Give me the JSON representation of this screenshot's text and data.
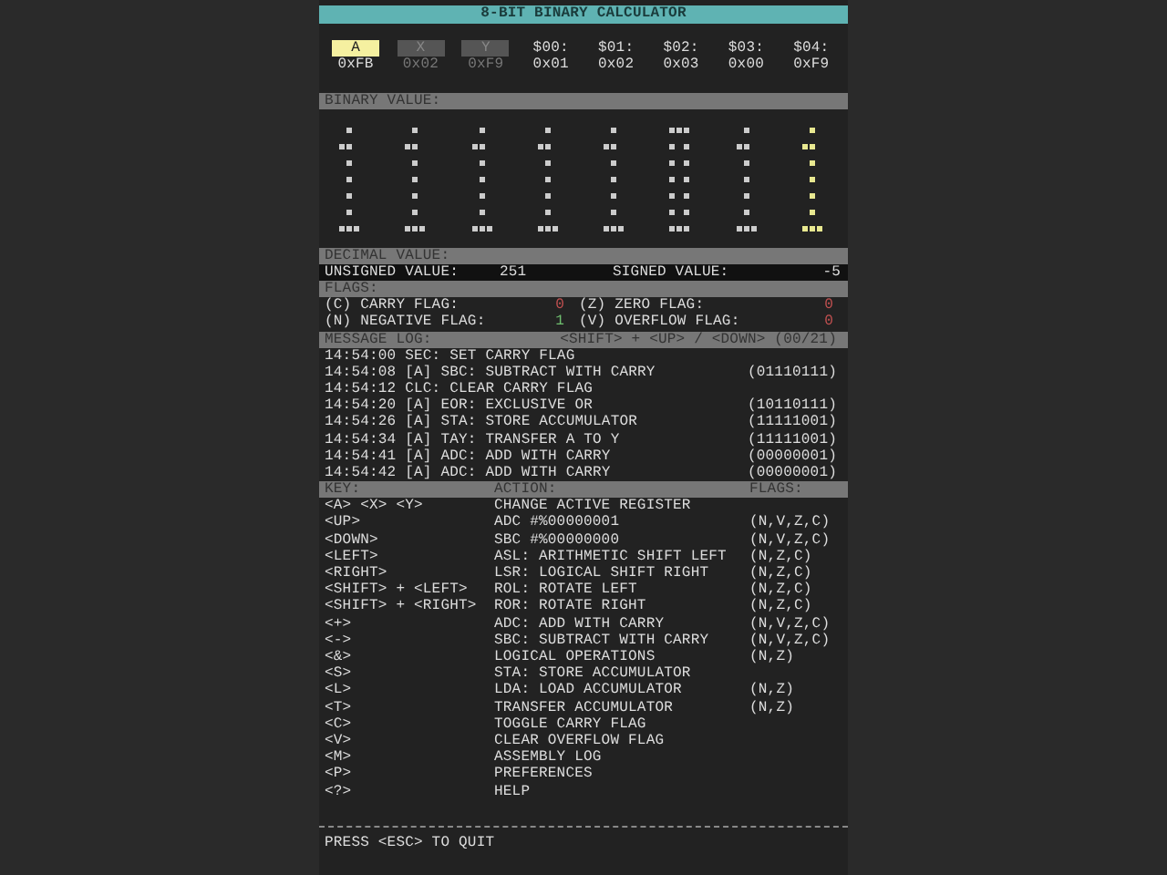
{
  "title": "8-BIT BINARY CALCULATOR",
  "registers": [
    {
      "label": "A",
      "value": "0xFB",
      "kind": "register",
      "selected": true
    },
    {
      "label": "X",
      "value": "0x02",
      "kind": "register",
      "selected": false
    },
    {
      "label": "Y",
      "value": "0xF9",
      "kind": "register",
      "selected": false
    },
    {
      "label": "$00:",
      "value": "0x01",
      "kind": "memory"
    },
    {
      "label": "$01:",
      "value": "0x02",
      "kind": "memory"
    },
    {
      "label": "$02:",
      "value": "0x03",
      "kind": "memory"
    },
    {
      "label": "$03:",
      "value": "0x00",
      "kind": "memory"
    },
    {
      "label": "$04:",
      "value": "0xF9",
      "kind": "memory"
    }
  ],
  "binary_header": "BINARY VALUE:",
  "bits": [
    {
      "on": true,
      "selected": false
    },
    {
      "on": true,
      "selected": false
    },
    {
      "on": true,
      "selected": false
    },
    {
      "on": true,
      "selected": false
    },
    {
      "on": true,
      "selected": false
    },
    {
      "on": false,
      "selected": false
    },
    {
      "on": true,
      "selected": false
    },
    {
      "on": true,
      "selected": true
    }
  ],
  "decimal": {
    "header": "DECIMAL VALUE:",
    "unsigned_label": "UNSIGNED VALUE:",
    "unsigned_value": "251",
    "signed_label": "SIGNED VALUE:",
    "signed_value": "-5"
  },
  "flags": {
    "header": "FLAGS:",
    "items": [
      {
        "label": "(C) CARRY FLAG:",
        "value": "0",
        "set": false
      },
      {
        "label": "(Z) ZERO FLAG:",
        "value": "0",
        "set": false
      },
      {
        "label": "(N) NEGATIVE FLAG:",
        "value": "1",
        "set": true
      },
      {
        "label": "(V) OVERFLOW FLAG:",
        "value": "0",
        "set": false
      }
    ]
  },
  "log": {
    "header": "MESSAGE LOG:",
    "hint": "<SHIFT> + <UP> / <DOWN> (00/21)",
    "entries": [
      {
        "text": "14:54:00 SEC: SET CARRY FLAG"
      },
      {
        "text": "14:54:08 [A] SBC: SUBTRACT WITH CARRY",
        "result": "(01110111)"
      },
      {
        "text": "14:54:12 CLC: CLEAR CARRY FLAG"
      },
      {
        "text": "14:54:20 [A] EOR: EXCLUSIVE OR",
        "result": "(10110111)"
      },
      {
        "text": "14:54:26 [A] STA: STORE ACCUMULATOR",
        "result": "(11111001)"
      },
      {
        "text": "14:54:34 [A] TAY: TRANSFER A TO Y",
        "result": "(11111001)"
      },
      {
        "text": "14:54:41 [A] ADC: ADD WITH CARRY",
        "result": "(00000001)"
      },
      {
        "text": "14:54:42 [A] ADC: ADD WITH CARRY",
        "result": "(00000001)"
      }
    ]
  },
  "keys": {
    "columns": [
      "KEY:",
      "ACTION:",
      "FLAGS:"
    ],
    "rows": [
      {
        "key": "<A> <X> <Y>",
        "action": "CHANGE ACTIVE REGISTER"
      },
      {
        "key": "<UP>",
        "action": "ADC #%00000001",
        "flags": "(N,V,Z,C)"
      },
      {
        "key": "<DOWN>",
        "action": "SBC #%00000000",
        "flags": "(N,V,Z,C)"
      },
      {
        "key": "<LEFT>",
        "action": "ASL: ARITHMETIC SHIFT LEFT",
        "flags": "(N,Z,C)"
      },
      {
        "key": "<RIGHT>",
        "action": "LSR: LOGICAL SHIFT RIGHT",
        "flags": "(N,Z,C)"
      },
      {
        "key": "<SHIFT> + <LEFT>",
        "action": "ROL: ROTATE LEFT",
        "flags": "(N,Z,C)"
      },
      {
        "key": "<SHIFT> + <RIGHT>",
        "action": "ROR: ROTATE RIGHT",
        "flags": "(N,Z,C)"
      },
      {
        "key": "<+>",
        "action": "ADC: ADD WITH CARRY",
        "flags": "(N,V,Z,C)"
      },
      {
        "key": "<->",
        "action": "SBC: SUBTRACT WITH CARRY",
        "flags": "(N,V,Z,C)"
      },
      {
        "key": "<&>",
        "action": "LOGICAL OPERATIONS",
        "flags": "(N,Z)"
      },
      {
        "key": "<S>",
        "action": "STA: STORE ACCUMULATOR"
      },
      {
        "key": "<L>",
        "action": "LDA: LOAD ACCUMULATOR",
        "flags": "(N,Z)"
      },
      {
        "key": "<T>",
        "action": "TRANSFER ACCUMULATOR",
        "flags": "(N,Z)"
      },
      {
        "key": "<C>",
        "action": "TOGGLE CARRY FLAG"
      },
      {
        "key": "<V>",
        "action": "CLEAR OVERFLOW FLAG"
      },
      {
        "key": "<M>",
        "action": "ASSEMBLY LOG"
      },
      {
        "key": "<P>",
        "action": "PREFERENCES"
      },
      {
        "key": "<?>",
        "action": "HELP"
      }
    ]
  },
  "footer": "PRESS <ESC> TO QUIT"
}
